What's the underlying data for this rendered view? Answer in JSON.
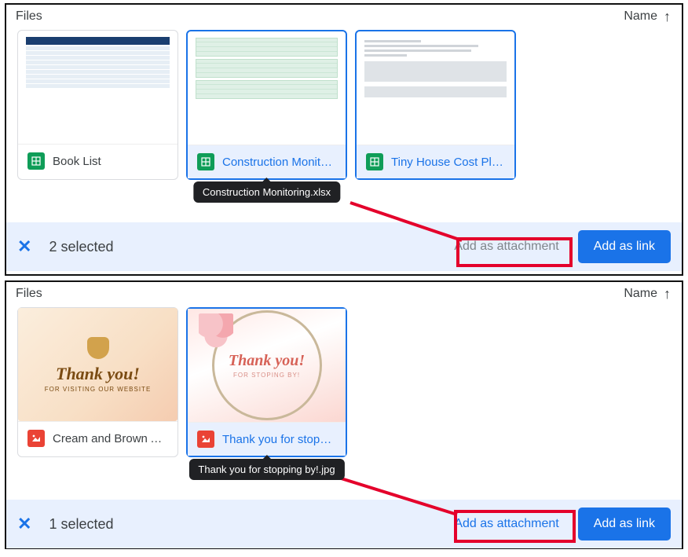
{
  "panelA": {
    "header": "Files",
    "sortLabel": "Name",
    "files": [
      {
        "name": "Book List",
        "selected": false,
        "kind": "sheet"
      },
      {
        "name": "Construction Monit…",
        "selected": true,
        "kind": "sheet",
        "tooltip": "Construction Monitoring.xlsx"
      },
      {
        "name": "Tiny House Cost Pl…",
        "selected": true,
        "kind": "sheet"
      }
    ],
    "selectionText": "2 selected",
    "addAttachment": "Add as attachment",
    "addLink": "Add as link",
    "attachmentEnabled": false
  },
  "panelB": {
    "header": "Files",
    "sortLabel": "Name",
    "files": [
      {
        "name": "Cream and Brown A…",
        "selected": false,
        "kind": "image",
        "thankyou_title": "Thank you!",
        "thankyou_sub": "FOR VISITING OUR WEBSITE"
      },
      {
        "name": "Thank you for stopp…",
        "selected": true,
        "kind": "image",
        "tooltip": "Thank you for stopping by!.jpg",
        "thankyou_title": "Thank you!",
        "thankyou_sub": "FOR STOPING BY!"
      }
    ],
    "selectionText": "1 selected",
    "addAttachment": "Add as attachment",
    "addLink": "Add as link",
    "attachmentEnabled": true
  }
}
